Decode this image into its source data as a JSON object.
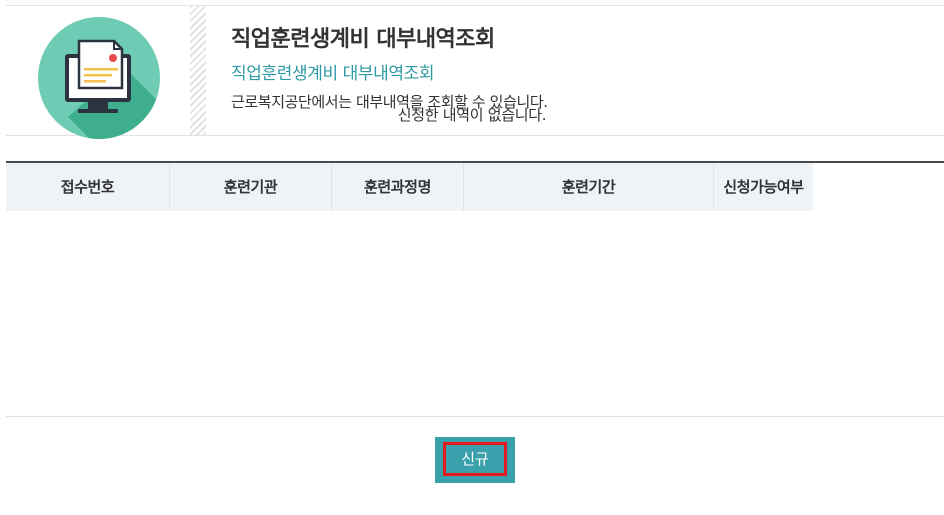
{
  "header": {
    "title": "직업훈련생계비 대부내역조회",
    "subtitle": "직업훈련생계비 대부내역조회",
    "description": "근로복지공단에서는 대부내역을 조회할 수 있습니다.",
    "illustration_icon": "computer-document-icon"
  },
  "table": {
    "columns": [
      "접수번호",
      "훈련기관",
      "훈련과정명",
      "훈련기간",
      "신청가능여부"
    ],
    "rows": [],
    "empty_message": "신청한 내역이 없습니다."
  },
  "actions": {
    "new_label": "신규"
  },
  "colors": {
    "accent": "#3aa0ab",
    "subtitle": "#2e9aa3",
    "highlight_border": "#e31b1b",
    "table_header_bg": "#eef3f8"
  }
}
